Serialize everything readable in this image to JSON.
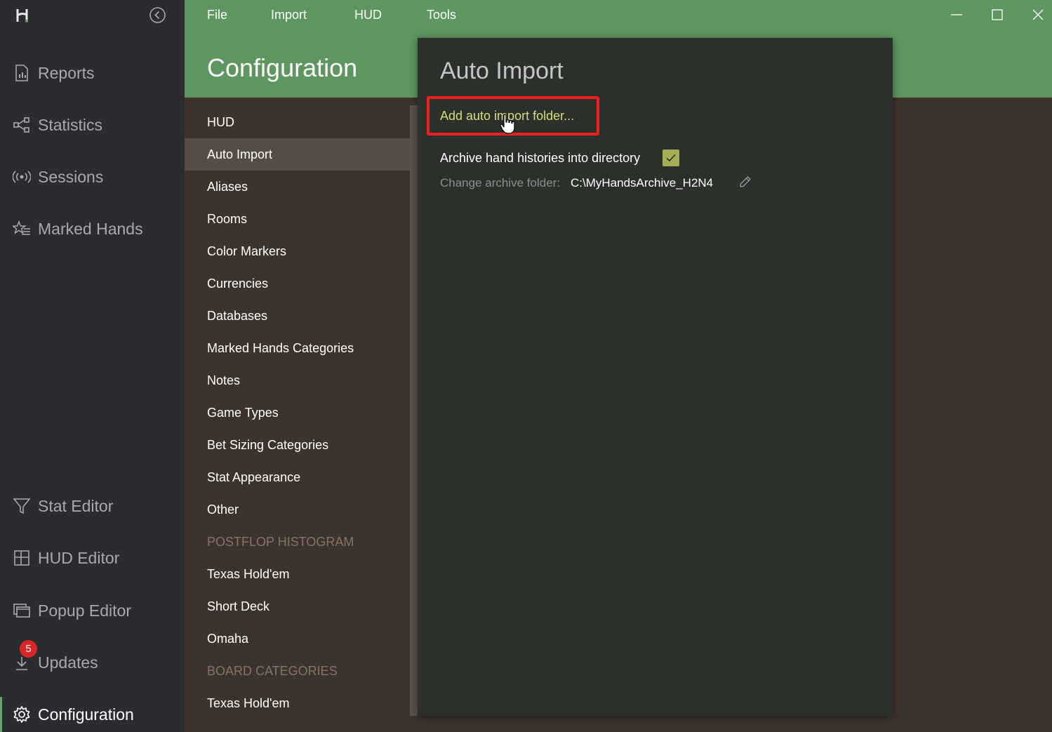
{
  "menu": {
    "file": "File",
    "import": "Import",
    "hud": "HUD",
    "tools": "Tools"
  },
  "header": {
    "title": "Configuration"
  },
  "nav": {
    "reports": "Reports",
    "statistics": "Statistics",
    "sessions": "Sessions",
    "marked_hands": "Marked Hands",
    "stat_editor": "Stat Editor",
    "hud_editor": "HUD Editor",
    "popup_editor": "Popup Editor",
    "updates": "Updates",
    "updates_badge": "5",
    "configuration": "Configuration"
  },
  "config_list": [
    "HUD",
    "Auto Import",
    "Aliases",
    "Rooms",
    "Color Markers",
    "Currencies",
    "Databases",
    "Marked Hands Categories",
    "Notes",
    "Game Types",
    "Bet Sizing Categories",
    "Stat Appearance",
    "Other",
    "POSTFLOP HISTOGRAM",
    "Texas Hold'em",
    "Short Deck",
    "Omaha",
    "BOARD CATEGORIES",
    "Texas Hold'em"
  ],
  "panel": {
    "title": "Auto Import",
    "add_folder": "Add auto import folder...",
    "archive_label": "Archive hand histories into directory",
    "archive_checked": true,
    "change_label": "Change archive folder:",
    "archive_path": "C:\\MyHandsArchive_H2N4"
  },
  "colors": {
    "accent": "#5e9660",
    "sidebar_bg": "#2b2c2f",
    "list_bg": "#3d332b",
    "panel_bg": "#2b302b",
    "link": "#d7dc79",
    "highlight": "#f31f1f",
    "badge": "#d9262b"
  }
}
